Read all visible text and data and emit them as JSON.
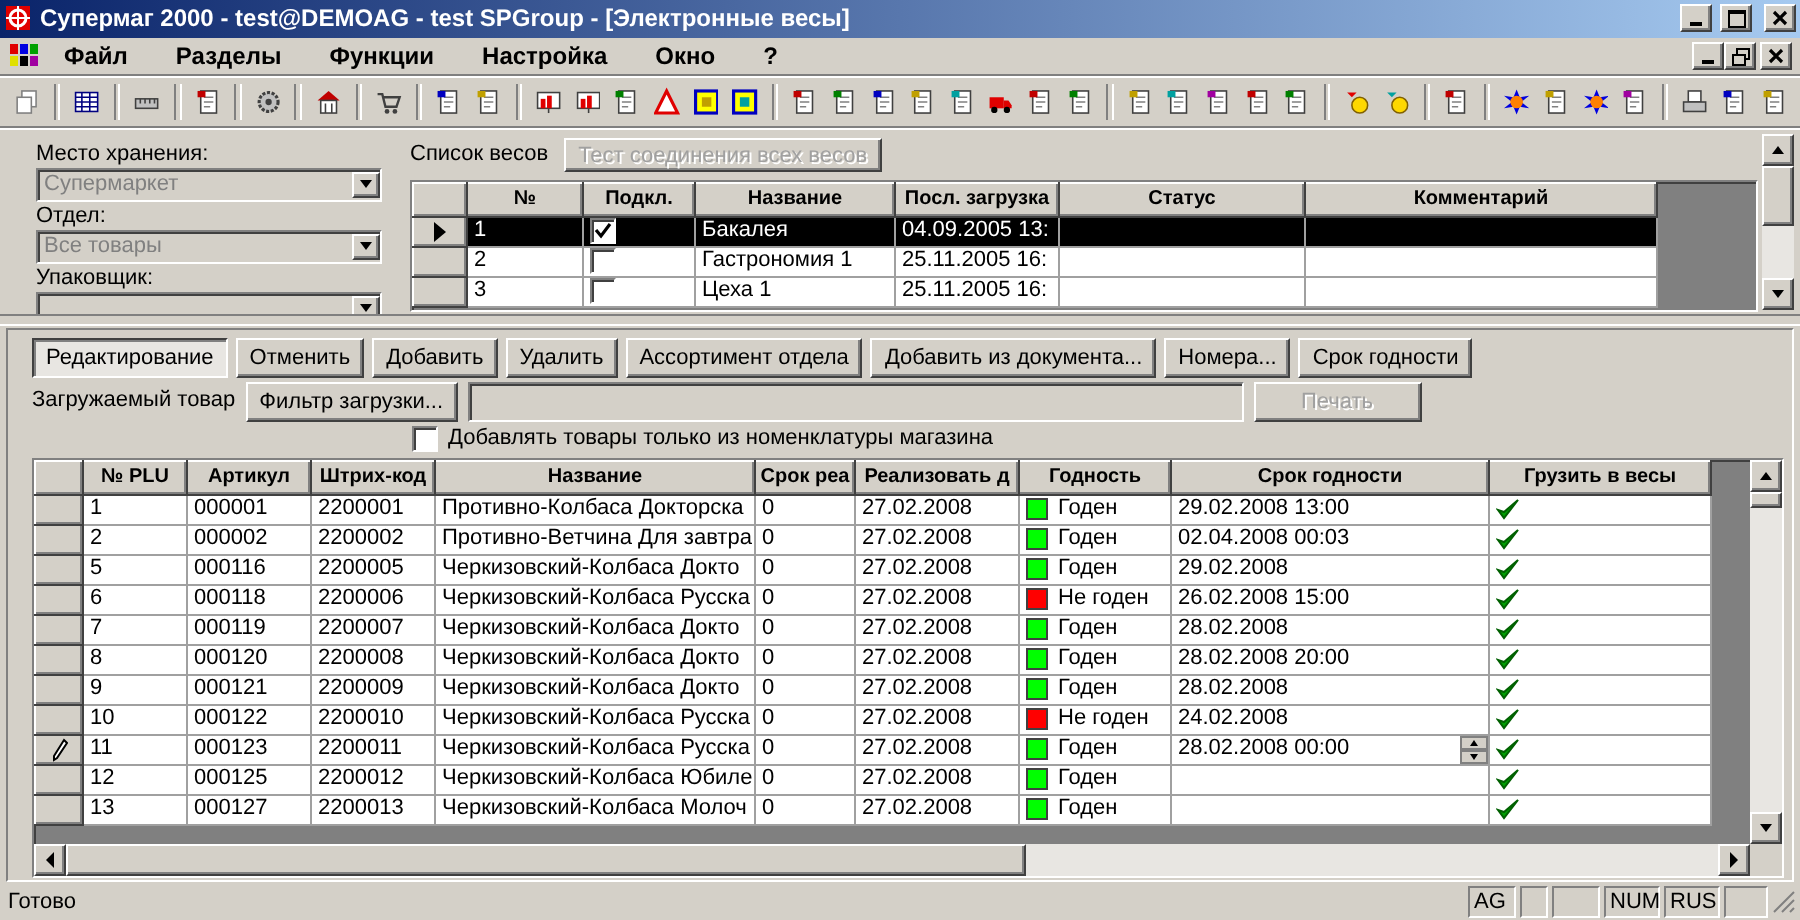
{
  "window": {
    "title": "Супермаг 2000 - test@DEMOAG - test SPGroup - [Электронные весы]"
  },
  "menu": [
    "Файл",
    "Разделы",
    "Функции",
    "Настройка",
    "Окно",
    "?"
  ],
  "filters": [
    {
      "label": "Место хранения:",
      "value": "Супермаркет",
      "disabled": true
    },
    {
      "label": "Отдел:",
      "value": "Все товары",
      "disabled": true
    },
    {
      "label": "Упаковщик:",
      "disabled": true
    }
  ],
  "scales": {
    "title": "Список весов",
    "test_button": {
      "label": "Тест соединения всех весов",
      "disabled": true
    },
    "columns": [
      "№",
      "Подкл.",
      "Название",
      "Посл. загрузка",
      "Статус",
      "Комментарий"
    ],
    "rows": [
      {
        "no": "1",
        "connected": true,
        "name": "Бакалея",
        "last_load": "04.09.2005 13:",
        "selected": true
      },
      {
        "no": "2",
        "connected": false,
        "name": "Гастрономия 1",
        "last_load": "25.11.2005 16:",
        "selected": false
      },
      {
        "no": "3",
        "connected": false,
        "name": "Цеха 1",
        "last_load": "25.11.2005 16:",
        "selected": false
      }
    ]
  },
  "actions": [
    {
      "label": "Редактирование",
      "pressed": true
    },
    {
      "label": "Отменить",
      "pressed": false
    },
    {
      "label": "Добавить",
      "pressed": false
    },
    {
      "label": "Удалить",
      "pressed": false
    },
    {
      "label": "Ассортимент отдела",
      "pressed": false
    },
    {
      "label": "Добавить из документа...",
      "pressed": false
    },
    {
      "label": "Номера...",
      "pressed": false
    },
    {
      "label": "Срок годности",
      "pressed": false
    }
  ],
  "load": {
    "label": "Загружаемый товар",
    "filter_button": "Фильтр загрузки...",
    "print_button": {
      "label": "Печать",
      "disabled": true
    },
    "only_store_items": {
      "label": "Добавлять товары только из номенклатуры магазина",
      "checked": false
    }
  },
  "goods": {
    "columns": [
      "№ PLU",
      "Артикул",
      "Штрих-код",
      "Название",
      "Срок реа",
      "Реализовать д",
      "Годность",
      "Срок годности",
      "Грузить в весы"
    ],
    "rows": [
      {
        "plu": "1",
        "article": "000001",
        "barcode": "2200001",
        "name": "Противно-Колбаса Докторска",
        "term": "0",
        "sell_by": "27.02.2008",
        "validity": "Годен",
        "color": "#00ff00",
        "expiry": "29.02.2008 13:00",
        "load": true,
        "editing": false
      },
      {
        "plu": "2",
        "article": "000002",
        "barcode": "2200002",
        "name": "Противно-Ветчина Для завтра",
        "term": "0",
        "sell_by": "27.02.2008",
        "validity": "Годен",
        "color": "#00ff00",
        "expiry": "02.04.2008 00:03",
        "load": true,
        "editing": false
      },
      {
        "plu": "5",
        "article": "000116",
        "barcode": "2200005",
        "name": "Черкизовский-Колбаса Докто",
        "term": "0",
        "sell_by": "27.02.2008",
        "validity": "Годен",
        "color": "#00ff00",
        "expiry": "29.02.2008",
        "load": true,
        "editing": false
      },
      {
        "plu": "6",
        "article": "000118",
        "barcode": "2200006",
        "name": "Черкизовский-Колбаса Русска",
        "term": "0",
        "sell_by": "27.02.2008",
        "validity": "Не годен",
        "color": "#ff0000",
        "expiry": "26.02.2008 15:00",
        "load": true,
        "editing": false
      },
      {
        "plu": "7",
        "article": "000119",
        "barcode": "2200007",
        "name": "Черкизовский-Колбаса Докто",
        "term": "0",
        "sell_by": "27.02.2008",
        "validity": "Годен",
        "color": "#00ff00",
        "expiry": "28.02.2008",
        "load": true,
        "editing": false
      },
      {
        "plu": "8",
        "article": "000120",
        "barcode": "2200008",
        "name": "Черкизовский-Колбаса Докто",
        "term": "0",
        "sell_by": "27.02.2008",
        "validity": "Годен",
        "color": "#00ff00",
        "expiry": "28.02.2008 20:00",
        "load": true,
        "editing": false
      },
      {
        "plu": "9",
        "article": "000121",
        "barcode": "2200009",
        "name": "Черкизовский-Колбаса Докто",
        "term": "0",
        "sell_by": "27.02.2008",
        "validity": "Годен",
        "color": "#00ff00",
        "expiry": "28.02.2008",
        "load": true,
        "editing": false
      },
      {
        "plu": "10",
        "article": "000122",
        "barcode": "2200010",
        "name": "Черкизовский-Колбаса Русска",
        "term": "0",
        "sell_by": "27.02.2008",
        "validity": "Не годен",
        "color": "#ff0000",
        "expiry": "24.02.2008",
        "load": true,
        "editing": false
      },
      {
        "plu": "11",
        "article": "000123",
        "barcode": "2200011",
        "name": "Черкизовский-Колбаса Русска",
        "term": "0",
        "sell_by": "27.02.2008",
        "validity": "Годен",
        "color": "#00ff00",
        "expiry": "28.02.2008 00:00",
        "load": true,
        "editing": true
      },
      {
        "plu": "12",
        "article": "000125",
        "barcode": "2200012",
        "name": "Черкизовский-Колбаса Юбиле",
        "term": "0",
        "sell_by": "27.02.2008",
        "validity": "Годен",
        "color": "#00ff00",
        "load": true,
        "editing": false
      },
      {
        "plu": "13",
        "article": "000127",
        "barcode": "2200013",
        "name": "Черкизовский-Колбаса Молоч",
        "term": "0",
        "sell_by": "27.02.2008",
        "validity": "Годен",
        "color": "#00ff00",
        "load": true,
        "editing": false
      }
    ]
  },
  "status_bar": {
    "message": "Готово",
    "indicators": [
      "AG",
      "NUM",
      "RUS"
    ]
  }
}
